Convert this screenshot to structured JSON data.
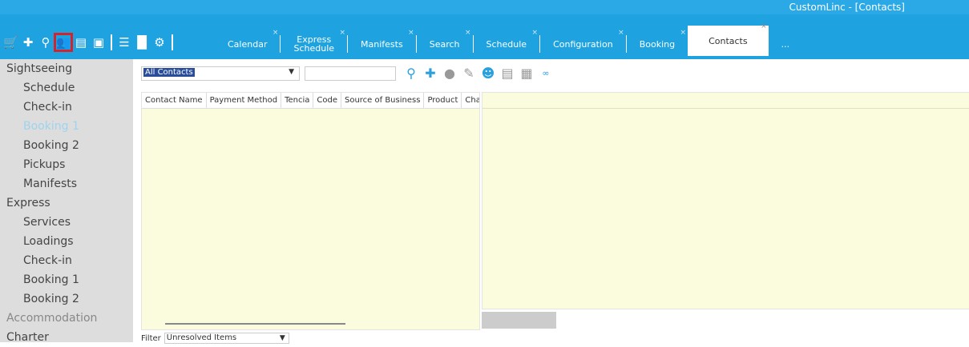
{
  "window": {
    "title": "CustomLinc - [Contacts]"
  },
  "toolbar": {
    "icons": [
      "cart-icon",
      "add-icon",
      "search-icon",
      "contacts-icon",
      "card-icon",
      "calendar-icon",
      "list-icon",
      "chart-icon",
      "gear-icon"
    ]
  },
  "tabs": [
    {
      "label": "Calendar"
    },
    {
      "label": "Express\nSchedule"
    },
    {
      "label": "Manifests"
    },
    {
      "label": "Search"
    },
    {
      "label": "Schedule"
    },
    {
      "label": "Configuration"
    },
    {
      "label": "Booking"
    },
    {
      "label": "Contacts",
      "active": true
    },
    {
      "label": "..."
    }
  ],
  "sidebar": {
    "items": [
      {
        "label": "Sightseeing",
        "level": 0
      },
      {
        "label": "Schedule",
        "level": 1
      },
      {
        "label": "Check-in",
        "level": 1
      },
      {
        "label": "Booking 1",
        "level": 1,
        "active": true
      },
      {
        "label": "Booking 2",
        "level": 1
      },
      {
        "label": "Pickups",
        "level": 1
      },
      {
        "label": "Manifests",
        "level": 1
      },
      {
        "label": "Express",
        "level": 0
      },
      {
        "label": "Services",
        "level": 1
      },
      {
        "label": "Loadings",
        "level": 1
      },
      {
        "label": "Check-in",
        "level": 1
      },
      {
        "label": "Booking 1",
        "level": 1
      },
      {
        "label": "Booking 2",
        "level": 1
      },
      {
        "label": "Accommodation",
        "level": 0,
        "dim": true
      },
      {
        "label": "Charter",
        "level": 0
      }
    ]
  },
  "contacts_filter": {
    "value": "All Contacts",
    "search_value": ""
  },
  "grid": {
    "columns": [
      "Contact Name",
      "Payment Method",
      "Tencia",
      "Code",
      "Source of Business",
      "Product",
      "Char"
    ]
  },
  "bottom_filter": {
    "label": "Filter",
    "value": "Unresolved Items"
  },
  "colors": {
    "accent": "#20a7e4",
    "highlight": "#d4232a",
    "grid_bg": "#fbfbdd"
  }
}
